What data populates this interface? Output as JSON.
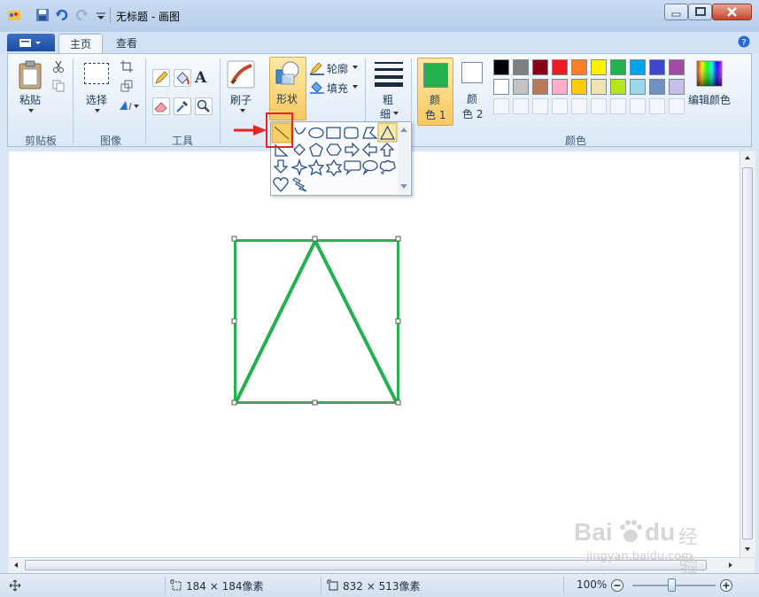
{
  "window": {
    "title": "无标题 - 画图"
  },
  "tabs": [
    {
      "label": "主页",
      "active": true
    },
    {
      "label": "查看",
      "active": false
    }
  ],
  "ribbon": {
    "clipboard": {
      "paste_label": "粘贴",
      "group_label": "剪贴板"
    },
    "image": {
      "select_label": "选择",
      "group_label": "图像"
    },
    "tools": {
      "group_label": "工具",
      "text_tool_glyph": "A"
    },
    "brushes": {
      "label": "刷子"
    },
    "shapes": {
      "label": "形状",
      "outline_label": "轮廓",
      "fill_label": "填充"
    },
    "size": {
      "label_line1": "粗",
      "label_line2": "细"
    },
    "colors": {
      "color1_line1": "颜",
      "color1_line2": "色 1",
      "color2_line1": "颜",
      "color2_line2": "色 2",
      "edit_colors_label": "编辑颜色",
      "group_label": "颜色",
      "color1_value": "#22b14c",
      "color2_value": "#ffffff",
      "palette_row1": [
        "#000000",
        "#7f7f7f",
        "#880015",
        "#ed1c24",
        "#ff7f27",
        "#fff200",
        "#22b14c",
        "#00a2e8",
        "#3f48cc",
        "#a349a4"
      ],
      "palette_row2": [
        "#ffffff",
        "#c3c3c3",
        "#b97a57",
        "#ffaec9",
        "#ffc90e",
        "#efe4b0",
        "#b5e61d",
        "#99d9ea",
        "#7092be",
        "#c8bfe7"
      ]
    }
  },
  "shapes_dropdown": {
    "items": [
      "line",
      "curve",
      "oval",
      "rectangle",
      "rounded-rectangle",
      "polygon",
      "triangle",
      "right-triangle",
      "diamond",
      "pentagon",
      "hexagon",
      "right-arrow",
      "left-arrow",
      "up-arrow",
      "down-arrow",
      "four-point-star",
      "five-point-star",
      "six-point-star",
      "rounded-callout",
      "oval-callout",
      "cloud-callout",
      "heart",
      "lightning"
    ],
    "highlighted": "line"
  },
  "statusbar": {
    "selection_size": "184 × 184像素",
    "canvas_size": "832 × 513像素",
    "zoom": "100%"
  },
  "drawing": {
    "stroke_color": "#22b14c"
  },
  "watermark": {
    "brand": "Bai",
    "brand2": "du",
    "cn": "经验",
    "url": "jingyan.baidu.com"
  }
}
